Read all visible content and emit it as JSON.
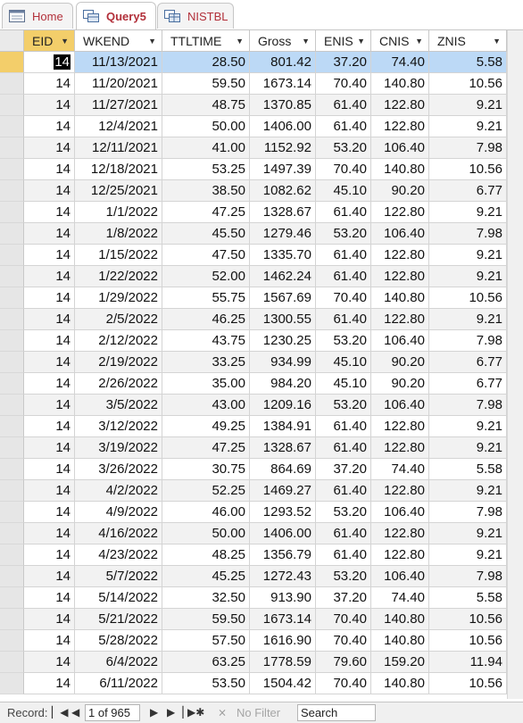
{
  "tabs": [
    {
      "label": "Home",
      "icon": "form-icon",
      "active": false
    },
    {
      "label": "Query5",
      "icon": "query-icon",
      "active": true
    },
    {
      "label": "NISTBL",
      "icon": "table-icon",
      "active": false
    }
  ],
  "columns": [
    {
      "label": "EID",
      "sort_icon": "dropdown-arrow-icon"
    },
    {
      "label": "WKEND",
      "sort_icon": "dropdown-arrow-icon"
    },
    {
      "label": "TTLTIME",
      "sort_icon": "dropdown-arrow-icon"
    },
    {
      "label": "Gross",
      "sort_icon": "dropdown-arrow-icon"
    },
    {
      "label": "ENIS",
      "sort_icon": "dropdown-arrow-icon"
    },
    {
      "label": "CNIS",
      "sort_icon": "dropdown-arrow-icon"
    },
    {
      "label": "ZNIS",
      "sort_icon": "dropdown-arrow-icon"
    }
  ],
  "rows": [
    [
      "14",
      "11/13/2021",
      "28.50",
      "801.42",
      "37.20",
      "74.40",
      "5.58"
    ],
    [
      "14",
      "11/20/2021",
      "59.50",
      "1673.14",
      "70.40",
      "140.80",
      "10.56"
    ],
    [
      "14",
      "11/27/2021",
      "48.75",
      "1370.85",
      "61.40",
      "122.80",
      "9.21"
    ],
    [
      "14",
      "12/4/2021",
      "50.00",
      "1406.00",
      "61.40",
      "122.80",
      "9.21"
    ],
    [
      "14",
      "12/11/2021",
      "41.00",
      "1152.92",
      "53.20",
      "106.40",
      "7.98"
    ],
    [
      "14",
      "12/18/2021",
      "53.25",
      "1497.39",
      "70.40",
      "140.80",
      "10.56"
    ],
    [
      "14",
      "12/25/2021",
      "38.50",
      "1082.62",
      "45.10",
      "90.20",
      "6.77"
    ],
    [
      "14",
      "1/1/2022",
      "47.25",
      "1328.67",
      "61.40",
      "122.80",
      "9.21"
    ],
    [
      "14",
      "1/8/2022",
      "45.50",
      "1279.46",
      "53.20",
      "106.40",
      "7.98"
    ],
    [
      "14",
      "1/15/2022",
      "47.50",
      "1335.70",
      "61.40",
      "122.80",
      "9.21"
    ],
    [
      "14",
      "1/22/2022",
      "52.00",
      "1462.24",
      "61.40",
      "122.80",
      "9.21"
    ],
    [
      "14",
      "1/29/2022",
      "55.75",
      "1567.69",
      "70.40",
      "140.80",
      "10.56"
    ],
    [
      "14",
      "2/5/2022",
      "46.25",
      "1300.55",
      "61.40",
      "122.80",
      "9.21"
    ],
    [
      "14",
      "2/12/2022",
      "43.75",
      "1230.25",
      "53.20",
      "106.40",
      "7.98"
    ],
    [
      "14",
      "2/19/2022",
      "33.25",
      "934.99",
      "45.10",
      "90.20",
      "6.77"
    ],
    [
      "14",
      "2/26/2022",
      "35.00",
      "984.20",
      "45.10",
      "90.20",
      "6.77"
    ],
    [
      "14",
      "3/5/2022",
      "43.00",
      "1209.16",
      "53.20",
      "106.40",
      "7.98"
    ],
    [
      "14",
      "3/12/2022",
      "49.25",
      "1384.91",
      "61.40",
      "122.80",
      "9.21"
    ],
    [
      "14",
      "3/19/2022",
      "47.25",
      "1328.67",
      "61.40",
      "122.80",
      "9.21"
    ],
    [
      "14",
      "3/26/2022",
      "30.75",
      "864.69",
      "37.20",
      "74.40",
      "5.58"
    ],
    [
      "14",
      "4/2/2022",
      "52.25",
      "1469.27",
      "61.40",
      "122.80",
      "9.21"
    ],
    [
      "14",
      "4/9/2022",
      "46.00",
      "1293.52",
      "53.20",
      "106.40",
      "7.98"
    ],
    [
      "14",
      "4/16/2022",
      "50.00",
      "1406.00",
      "61.40",
      "122.80",
      "9.21"
    ],
    [
      "14",
      "4/23/2022",
      "48.25",
      "1356.79",
      "61.40",
      "122.80",
      "9.21"
    ],
    [
      "14",
      "5/7/2022",
      "45.25",
      "1272.43",
      "53.20",
      "106.40",
      "7.98"
    ],
    [
      "14",
      "5/14/2022",
      "32.50",
      "913.90",
      "37.20",
      "74.40",
      "5.58"
    ],
    [
      "14",
      "5/21/2022",
      "59.50",
      "1673.14",
      "70.40",
      "140.80",
      "10.56"
    ],
    [
      "14",
      "5/28/2022",
      "57.50",
      "1616.90",
      "70.40",
      "140.80",
      "10.56"
    ],
    [
      "14",
      "6/4/2022",
      "63.25",
      "1778.59",
      "79.60",
      "159.20",
      "11.94"
    ],
    [
      "14",
      "6/11/2022",
      "53.50",
      "1504.42",
      "70.40",
      "140.80",
      "10.56"
    ]
  ],
  "navbar": {
    "record_label": "Record:",
    "first_icon": "first-record-icon",
    "prev_icon": "previous-record-icon",
    "position": "1 of 965",
    "next_icon": "next-record-icon",
    "last_icon": "last-record-icon",
    "new_icon": "new-record-icon",
    "filter_icon": "filter-icon",
    "filter_label": "No Filter",
    "search_value": "Search"
  }
}
